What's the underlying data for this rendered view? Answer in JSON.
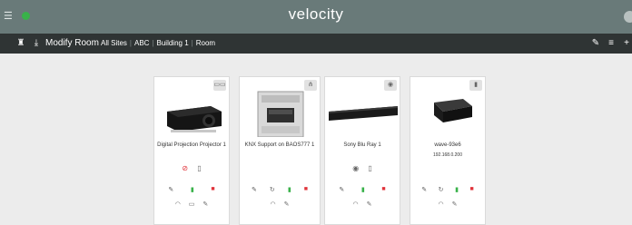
{
  "topbar": {
    "brand": "velocity",
    "menu_icon": "hamburger-icon",
    "status_color": "#39b24a"
  },
  "subbar": {
    "title": "Modify Room",
    "breadcrumbs": [
      "All Sites",
      "ABC",
      "Building 1",
      "Room"
    ]
  },
  "devices": [
    {
      "name": "Digital Projection Projector 1",
      "ip": "",
      "badge_icon": "connector-icon"
    },
    {
      "name": "KNX Support on BAOS777 1",
      "ip": "",
      "badge_icon": "network-icon"
    },
    {
      "name": "Sony Blu Ray 1",
      "ip": "",
      "badge_icon": "ir-icon"
    },
    {
      "name": "wave-93e6",
      "ip": "192.168.0.200",
      "badge_icon": "remote-icon"
    }
  ],
  "colors": {
    "topbar": "#697a79",
    "subbar": "#2f3434",
    "green": "#39b24a",
    "red": "#e0333a"
  }
}
